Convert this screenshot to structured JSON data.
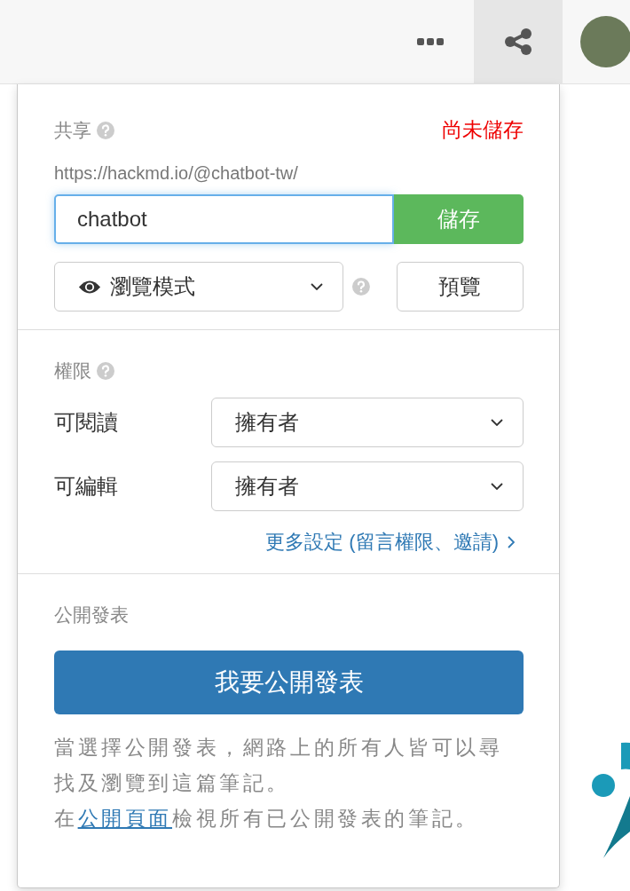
{
  "toolbar": {
    "share_button": {
      "selected": true
    }
  },
  "share": {
    "title": "共享",
    "status": "尚未儲存",
    "url_prefix": "https://hackmd.io/@chatbot-tw/",
    "slug_value": "chatbot",
    "save_button": "儲存",
    "mode_select": "瀏覽模式",
    "preview_button": "預覽"
  },
  "permissions": {
    "title": "權限",
    "rows": [
      {
        "label": "可閱讀",
        "value": "擁有者"
      },
      {
        "label": "可編輯",
        "value": "擁有者"
      }
    ],
    "more_link": "更多設定 (留言權限、邀請)"
  },
  "publish": {
    "title": "公開發表",
    "button": "我要公開發表",
    "note": "當選擇公開發表，網路上的所有人皆可以尋找及瀏覽到這篇筆記。",
    "note2_before": "在",
    "note2_link": "公開頁面",
    "note2_after": "檢視所有已公開發表的筆記。"
  }
}
